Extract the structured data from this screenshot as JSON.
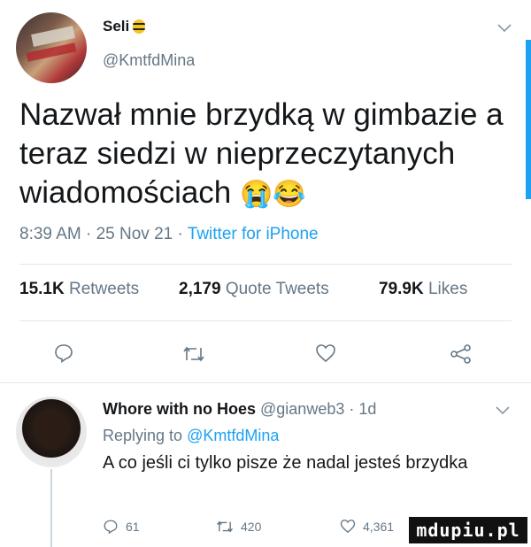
{
  "tweet": {
    "author_name": "Seli",
    "author_handle": "@KmtfdMina",
    "text": "Nazwał mnie brzydką w gimbazie a teraz siedzi w nieprzeczytanych wiadomościach",
    "emoji": "😭😂",
    "time": "8:39 AM",
    "date": "25 Nov 21",
    "source": "Twitter for iPhone",
    "separator": "·"
  },
  "stats": {
    "retweets_count": "15.1K",
    "retweets_label": "Retweets",
    "quotes_count": "2,179",
    "quotes_label": "Quote Tweets",
    "likes_count": "79.9K",
    "likes_label": "Likes"
  },
  "icons": {
    "reply": "reply-icon",
    "retweet": "retweet-icon",
    "like": "heart-icon",
    "share": "share-icon",
    "more": "chevron-down-icon"
  },
  "reply": {
    "author_name": "Whore with no Hoes",
    "author_handle": "@gianweb3",
    "age": "1d",
    "separator": "·",
    "replying_label": "Replying to",
    "replying_handle": "@KmtfdMina",
    "text": "A co jeśli ci tylko pisze że nadal jesteś brzydka",
    "reply_count": "61",
    "retweet_count": "420",
    "like_count": "4,361"
  },
  "watermark": "mdupiu.pl",
  "colors": {
    "link": "#1da1f2",
    "muted": "#657786",
    "text": "#14171a",
    "divider": "#e1e8ed"
  }
}
